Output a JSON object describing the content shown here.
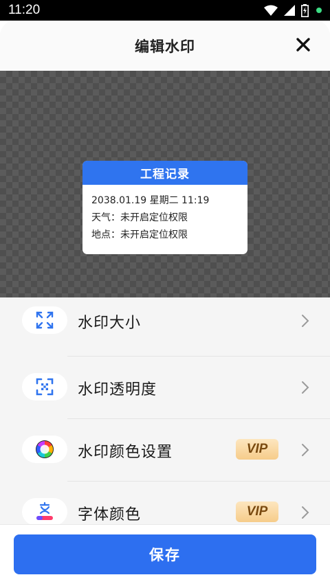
{
  "status_bar": {
    "time": "11:20"
  },
  "sheet": {
    "title": "编辑水印"
  },
  "watermark": {
    "header": "工程记录",
    "lines": [
      "2038.01.19 星期二 11:19",
      "天气：未开启定位权限",
      "地点：未开启定位权限"
    ]
  },
  "options": [
    {
      "label": "水印大小",
      "icon": "expand-icon",
      "vip": ""
    },
    {
      "label": "水印透明度",
      "icon": "opacity-icon",
      "vip": ""
    },
    {
      "label": "水印颜色设置",
      "icon": "color-wheel-icon",
      "vip": "VIP"
    },
    {
      "label": "字体颜色",
      "icon": "font-color-icon",
      "vip": "VIP"
    }
  ],
  "footer": {
    "save_label": "保存"
  },
  "colors": {
    "accent": "#2d6ff0",
    "watermark_header": "#2f74ef",
    "vip_text": "#7a4a10"
  }
}
